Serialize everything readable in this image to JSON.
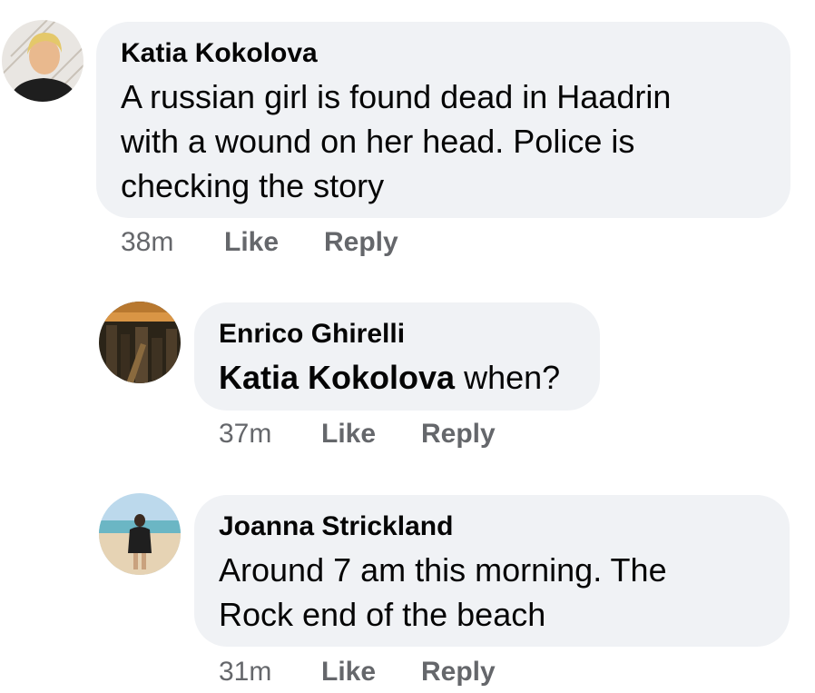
{
  "comments": [
    {
      "author": "Katia Kokolova",
      "lines": [
        "A russian girl is found dead in Haadrin",
        "with a wound on her head. Police is",
        "checking the story"
      ],
      "time": "38m",
      "like_label": "Like",
      "reply_label": "Reply"
    },
    {
      "author": "Enrico Ghirelli",
      "mention": "Katia Kokolova",
      "text_after_mention": " when?",
      "time": "37m",
      "like_label": "Like",
      "reply_label": "Reply"
    },
    {
      "author": "Joanna Strickland",
      "lines": [
        "Around 7 am this morning. The",
        "Rock end of the beach"
      ],
      "time": "31m",
      "like_label": "Like",
      "reply_label": "Reply"
    }
  ],
  "colors": {
    "bubble": "#f0f2f5",
    "text": "#050505",
    "meta": "#65676b"
  }
}
